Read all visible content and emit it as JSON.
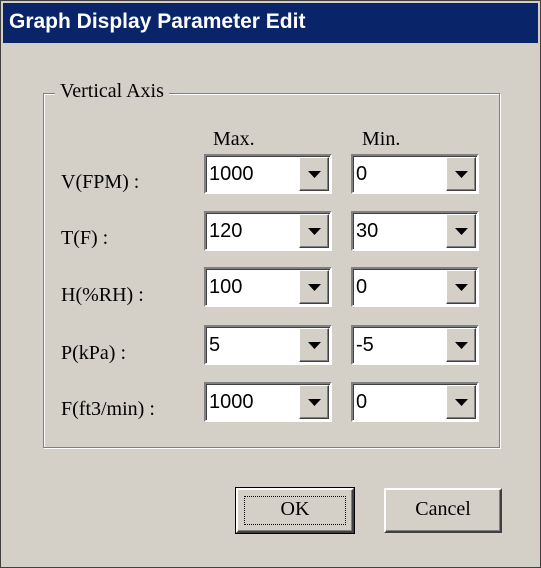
{
  "window": {
    "title": "Graph Display Parameter Edit"
  },
  "group": {
    "label": "Vertical Axis"
  },
  "columns": {
    "max": "Max.",
    "min": "Min."
  },
  "rows": [
    {
      "label": "V(FPM) :",
      "max": "1000",
      "min": "0"
    },
    {
      "label": "T(F) :",
      "max": "120",
      "min": "30"
    },
    {
      "label": "H(%RH) :",
      "max": "100",
      "min": "0"
    },
    {
      "label": "P(kPa) :",
      "max": "5",
      "min": "-5"
    },
    {
      "label": "F(ft3/min) :",
      "max": "1000",
      "min": "0"
    }
  ],
  "buttons": {
    "ok": "OK",
    "cancel": "Cancel"
  },
  "icons": {
    "dropdown": "dropdown-arrow-icon"
  }
}
